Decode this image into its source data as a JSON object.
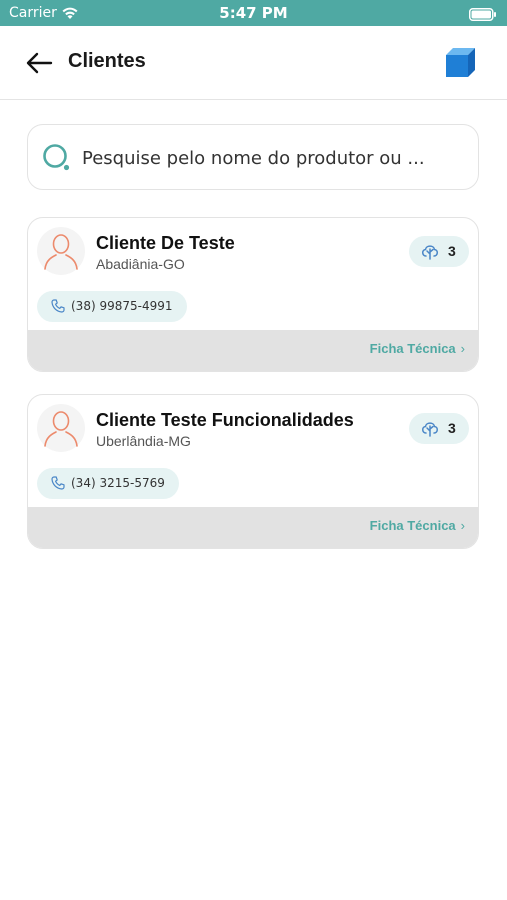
{
  "status_bar": {
    "carrier": "Carrier",
    "time": "5:47 PM"
  },
  "header": {
    "title": "Clientes",
    "back_icon": "arrow-left-icon",
    "action_icon": "box-icon"
  },
  "search": {
    "placeholder": "Pesquise pelo nome do produtor ou ...",
    "value": ""
  },
  "clients": [
    {
      "name": "Cliente De Teste",
      "location": "Abadiânia-GO",
      "badge_count": "3",
      "phone": "(38) 99875-4991",
      "link_label": "Ficha Técnica"
    },
    {
      "name": "Cliente Teste Funcionalidades",
      "location": "Uberlândia-MG",
      "badge_count": "3",
      "phone": "(34) 3215-5769",
      "link_label": "Ficha Técnica"
    }
  ],
  "colors": {
    "accent": "#4fa9a3",
    "avatar_stroke": "#ec8a6c",
    "badge_bg": "#e6f3f3",
    "box_icon": "#1f7fd6"
  }
}
